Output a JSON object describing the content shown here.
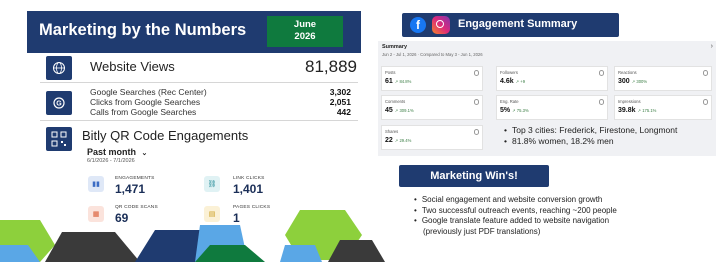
{
  "header": {
    "title": "Marketing by the Numbers",
    "month": "June",
    "year": "2026"
  },
  "website": {
    "label": "Website Views",
    "value": "81,889",
    "google": [
      {
        "label": "Google Searches (Rec Center)",
        "value": "3,302"
      },
      {
        "label": "Clicks from Google Searches",
        "value": "2,051"
      },
      {
        "label": "Calls from Google Searches",
        "value": "442"
      }
    ]
  },
  "bitly": {
    "title": "Bitly QR Code Engagements",
    "period": "Past month",
    "range": "6/1/2026 - 7/1/2026",
    "stats": [
      {
        "label": "ENGAGEMENTS",
        "value": "1,471",
        "icon": "bar-chart-icon"
      },
      {
        "label": "LINK CLICKS",
        "value": "1,401",
        "icon": "link-icon"
      },
      {
        "label": "QR CODE SCANS",
        "value": "69",
        "icon": "qr-scan-icon"
      },
      {
        "label": "PAGES CLICKS",
        "value": "1",
        "icon": "page-icon"
      }
    ]
  },
  "engagement": {
    "title": "Engagement Summary",
    "summary_title": "Summary",
    "summary_sub": "Jun 2 - Jul 1, 2026 · Compared to May 3 - Jun 1, 2026",
    "cards": [
      {
        "label": "Posts",
        "value": "61",
        "change": "↗ 84.8%"
      },
      {
        "label": "Followers",
        "value": "4.6k",
        "change": "↗ +9"
      },
      {
        "label": "Reactions",
        "value": "300",
        "change": "↗ 300%"
      },
      {
        "label": "Comments",
        "value": "45",
        "change": "↗ 309.1%"
      },
      {
        "label": "Eng. Rate",
        "value": "5%",
        "change": "↗ 75.3%"
      },
      {
        "label": "Impressions",
        "value": "39.8k",
        "change": "↗ 175.1%"
      },
      {
        "label": "Shares",
        "value": "22",
        "change": "↗ 29.4%"
      }
    ],
    "bullets": [
      "Top 3 cities: Frederick, Firestone, Longmont",
      "81.8% women, 18.2% men"
    ]
  },
  "wins": {
    "title": "Marketing Win's!",
    "items": [
      "Social engagement and website conversion growth",
      "Two successful outreach events, reaching ~200 people",
      "Google translate feature added to website navigation",
      "(previously just PDF translations)"
    ]
  },
  "colors": {
    "navy": "#1f3b70",
    "green": "#0f7a3e",
    "accent_green": "#8dd03c",
    "light_blue": "#5aa7e6"
  }
}
